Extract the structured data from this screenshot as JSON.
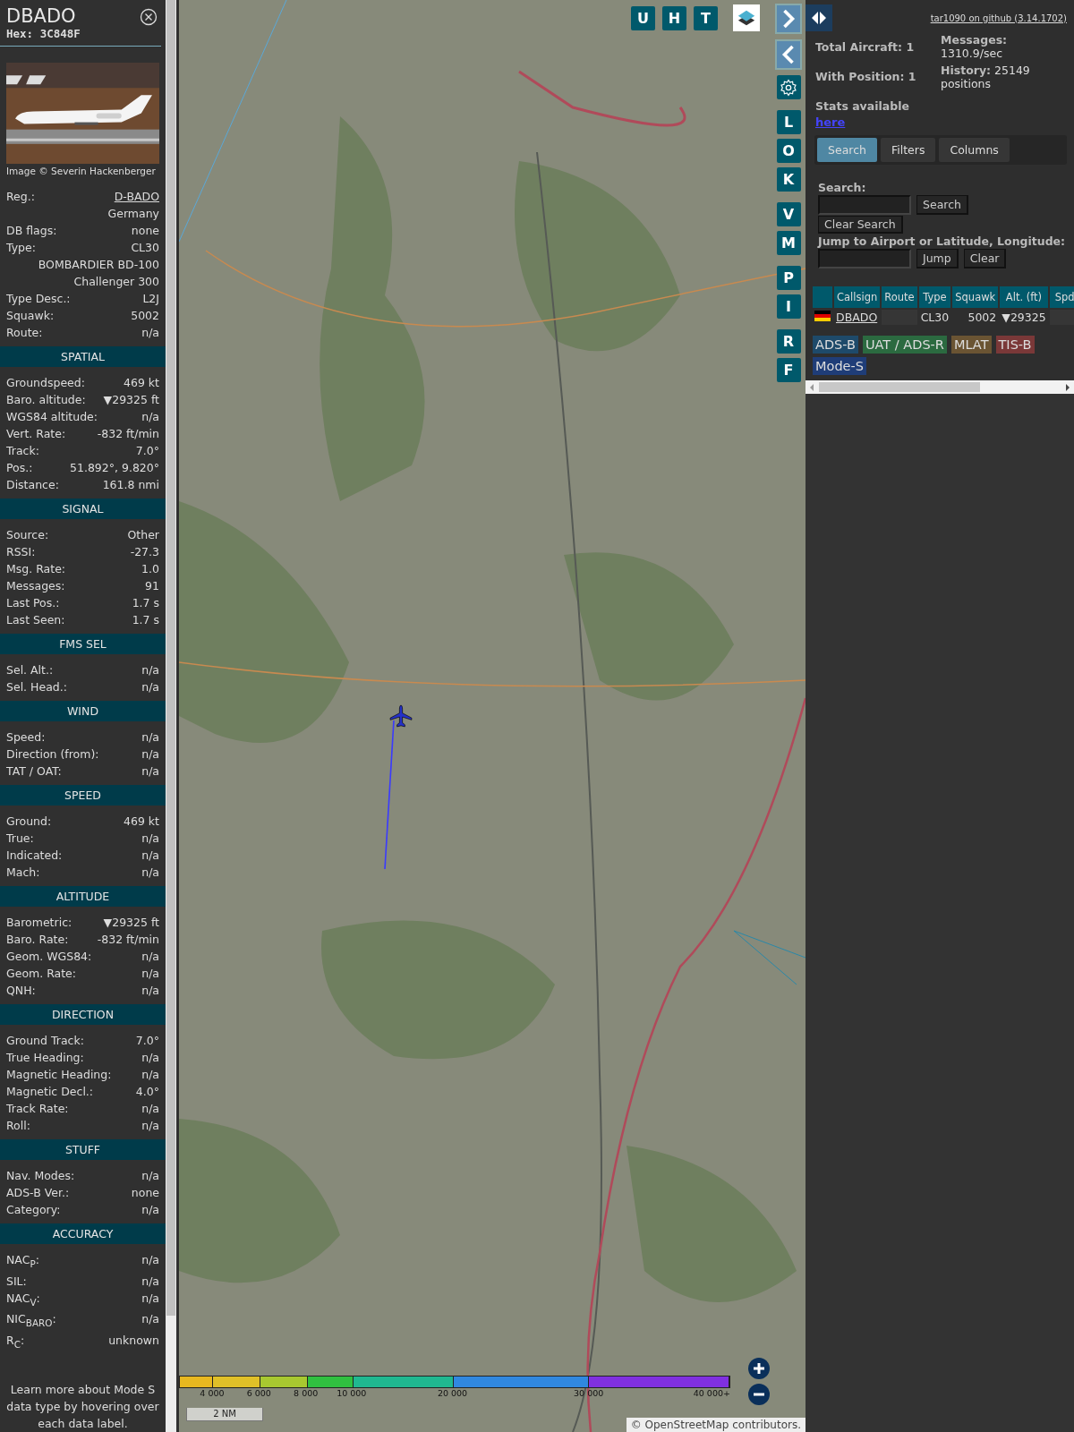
{
  "aircraft": {
    "callsign": "DBADO",
    "hex": "Hex: 3C848F",
    "photo_credit": "Image © Severin Hackenberger"
  },
  "info_rows": [
    {
      "label": "Reg.:",
      "value": "D-BADO",
      "kind": "link"
    },
    {
      "value": "Germany",
      "kind": "text"
    },
    {
      "label": "DB flags:",
      "value": "none",
      "kind": "text"
    },
    {
      "label": "Type:",
      "value": "CL30",
      "kind": "text"
    },
    {
      "value": "BOMBARDIER BD-100 Challenger 300",
      "kind": "text"
    },
    {
      "label": "Type Desc.:",
      "value": "L2J",
      "kind": "text"
    },
    {
      "label": "Squawk:",
      "value": "5002",
      "kind": "text"
    },
    {
      "label": "Route:",
      "value": "n/a",
      "kind": "text"
    }
  ],
  "sections": [
    {
      "title": "SPATIAL",
      "rows": [
        {
          "label": "Groundspeed:",
          "value": "469 kt"
        },
        {
          "label": "Baro. altitude:",
          "value": "▼29325 ft"
        },
        {
          "label": "WGS84 altitude:",
          "value": "n/a"
        },
        {
          "label": "Vert. Rate:",
          "value": "-832 ft/min"
        },
        {
          "label": "Track:",
          "value": "7.0°"
        },
        {
          "label": "Pos.:",
          "value": "51.892°, 9.820°"
        },
        {
          "label": "Distance:",
          "value": "161.8 nmi"
        }
      ]
    },
    {
      "title": "SIGNAL",
      "rows": [
        {
          "label": "Source:",
          "value": "Other"
        },
        {
          "label": "RSSI:",
          "value": "-27.3"
        },
        {
          "label": "Msg. Rate:",
          "value": "1.0"
        },
        {
          "label": "Messages:",
          "value": "91"
        },
        {
          "label": "Last Pos.:",
          "value": "1.7 s"
        },
        {
          "label": "Last Seen:",
          "value": "1.7 s"
        }
      ]
    },
    {
      "title": "FMS SEL",
      "rows": [
        {
          "label": "Sel. Alt.:",
          "value": "n/a"
        },
        {
          "label": "Sel. Head.:",
          "value": "n/a"
        }
      ]
    },
    {
      "title": "WIND",
      "rows": [
        {
          "label": "Speed:",
          "value": "n/a"
        },
        {
          "label": "Direction (from):",
          "value": "n/a"
        },
        {
          "label": "TAT / OAT:",
          "value": "n/a"
        }
      ]
    },
    {
      "title": "SPEED",
      "rows": [
        {
          "label": "Ground:",
          "value": "469 kt"
        },
        {
          "label": "True:",
          "value": "n/a"
        },
        {
          "label": "Indicated:",
          "value": "n/a"
        },
        {
          "label": "Mach:",
          "value": "n/a"
        }
      ]
    },
    {
      "title": "ALTITUDE",
      "rows": [
        {
          "label": "Barometric:",
          "value": "▼29325 ft"
        },
        {
          "label": "Baro. Rate:",
          "value": "-832 ft/min"
        },
        {
          "label": "Geom. WGS84:",
          "value": "n/a"
        },
        {
          "label": "Geom. Rate:",
          "value": "n/a"
        },
        {
          "label": "QNH:",
          "value": "n/a"
        }
      ]
    },
    {
      "title": "DIRECTION",
      "rows": [
        {
          "label": "Ground Track:",
          "value": "7.0°"
        },
        {
          "label": "True Heading:",
          "value": "n/a"
        },
        {
          "label": "Magnetic Heading:",
          "value": "n/a"
        },
        {
          "label": "Magnetic Decl.:",
          "value": "4.0°"
        },
        {
          "label": "Track Rate:",
          "value": "n/a"
        },
        {
          "label": "Roll:",
          "value": "n/a"
        }
      ]
    },
    {
      "title": "STUFF",
      "rows": [
        {
          "label": "Nav. Modes:",
          "value": "n/a"
        },
        {
          "label": "ADS-B Ver.:",
          "value": "none"
        },
        {
          "label": "Category:",
          "value": "n/a"
        }
      ]
    },
    {
      "title": "ACCURACY",
      "rows": [
        {
          "label": "NAC$_{P}$:",
          "value": "n/a"
        },
        {
          "label": "SIL:",
          "value": "n/a"
        },
        {
          "label": "NAC$_{V}$:",
          "value": "n/a"
        },
        {
          "label": "NIC$_{BARO}$:",
          "value": "n/a"
        },
        {
          "label": "R$_{C}$:",
          "value": "unknown"
        }
      ]
    }
  ],
  "help_text": "Learn more about Mode S data type by hovering over each data label.",
  "map": {
    "top_buttons": [
      "U",
      "H",
      "T"
    ],
    "side_buttons": [
      [
        "L",
        "O",
        "K"
      ],
      [
        "V",
        "M"
      ],
      [
        "P",
        "I"
      ],
      [
        "R",
        "F"
      ]
    ],
    "altitude_legend": [
      "4 000",
      "6 000",
      "8 000",
      "10 000",
      "20 000",
      "30 000",
      "40 000+"
    ],
    "scale": "2 NM",
    "attribution": "© OpenStreetMap contributors."
  },
  "header": {
    "github": "tar1090 on github (3.14.1702)"
  },
  "stats": {
    "total": "Total Aircraft: 1",
    "with_position": "With Position: 1",
    "stats_text": "Stats available",
    "stats_link": "here",
    "messages": "**Messages:** 1310.9/sec",
    "history": "**History:** 25149 positions"
  },
  "tabs": [
    {
      "label": "Search",
      "selected": true
    },
    {
      "label": "Filters",
      "selected": false
    },
    {
      "label": "Columns",
      "selected": false
    }
  ],
  "search": {
    "label": "Search:",
    "search_button": "Search",
    "clear_button": "Clear Search",
    "jump_label": "Jump to Airport or Latitude, Longitude:",
    "jump_button": "Jump",
    "jump_clear": "Clear"
  },
  "table": {
    "columns": [
      "Callsign",
      "Route",
      "Type",
      "Squawk",
      "Alt. (ft)",
      "Spd"
    ],
    "rows": [
      {
        "callsign": "DBADO",
        "type": "CL30",
        "squawk": "5002",
        "altitude": "▼29325"
      }
    ]
  },
  "source_tags": [
    {
      "label": "ADS-B",
      "color": "#1e4a6a"
    },
    {
      "label": "UAT / ADS-R",
      "color": "#2b6a40"
    },
    {
      "label": "MLAT",
      "color": "#6a5433"
    },
    {
      "label": "TIS-B",
      "color": "#7a3838"
    },
    {
      "label": "Mode-S",
      "color": "#1f3d78"
    }
  ]
}
